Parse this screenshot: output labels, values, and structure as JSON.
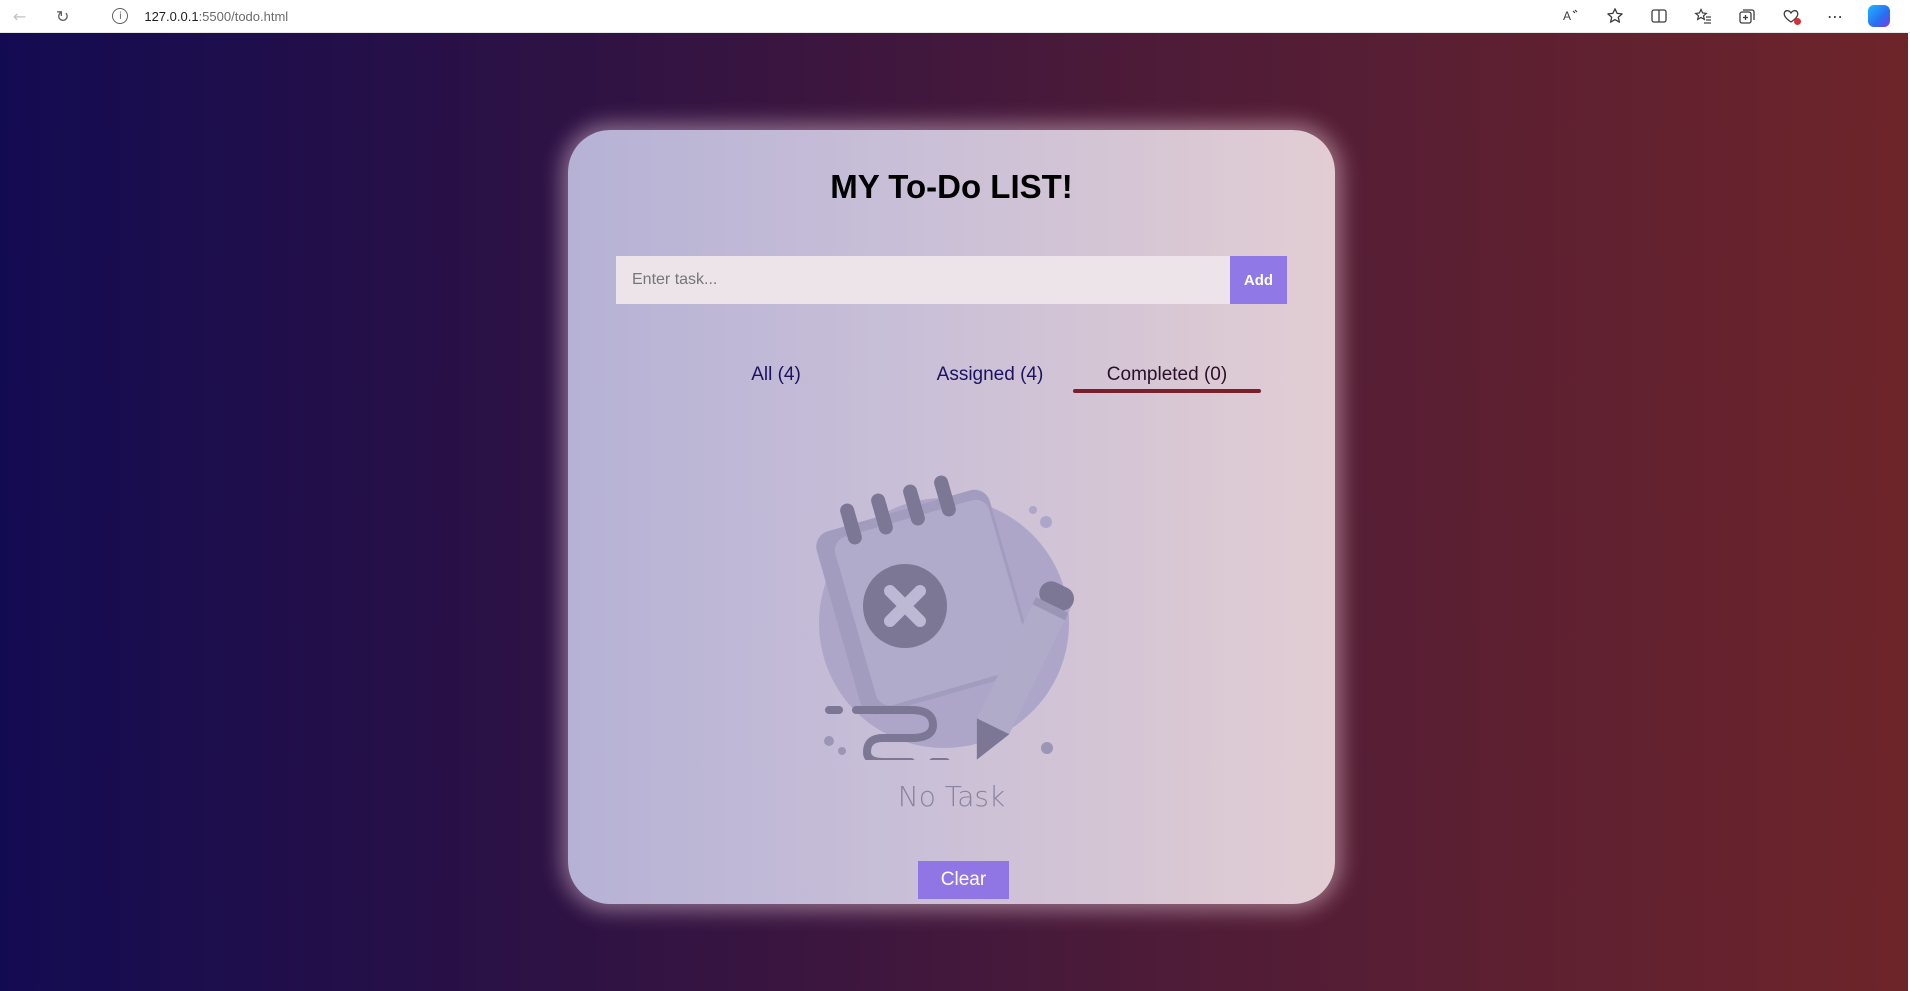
{
  "browser": {
    "url_host": "127.0.0.1",
    "url_rest": ":5500/todo.html",
    "back_icon": "←",
    "reload_icon": "↻",
    "info_icon": "i",
    "more_icon": "⋯"
  },
  "app": {
    "title": "MY To-Do LIST!",
    "input": {
      "placeholder": "Enter task...",
      "value": ""
    },
    "add_label": "Add",
    "tabs": [
      {
        "label": "All (4)",
        "active": false
      },
      {
        "label": "Assigned (4)",
        "active": false
      },
      {
        "label": "Completed (0)",
        "active": true
      }
    ],
    "empty_state": {
      "icon": "empty-notepad-icon",
      "text": "No Task"
    },
    "clear_label": "Clear"
  },
  "colors": {
    "accent": "#9079e6",
    "tab_underline": "#7b1f2c",
    "background_left": "#130b52",
    "background_right": "#6e252a"
  }
}
